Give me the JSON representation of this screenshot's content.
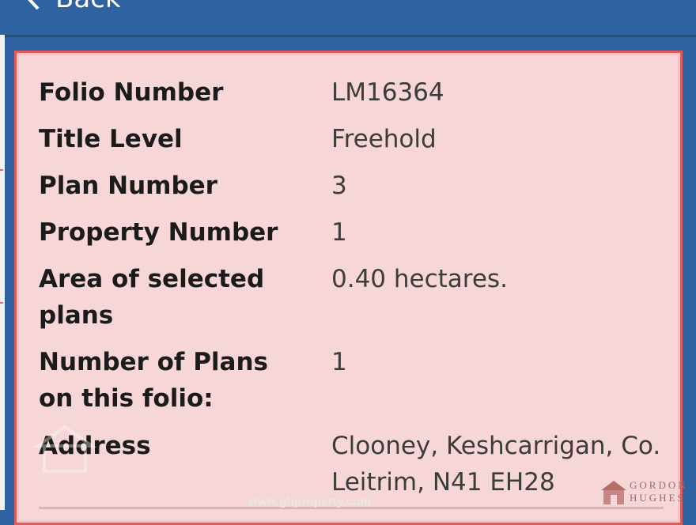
{
  "header": {
    "back_label": "Back"
  },
  "details": {
    "rows": [
      {
        "label": "Folio Number",
        "value": "LM16364"
      },
      {
        "label": "Title Level",
        "value": "Freehold"
      },
      {
        "label": "Plan Number",
        "value": "3"
      },
      {
        "label": "Property Number",
        "value": "1"
      },
      {
        "label": "Area of selected plans",
        "value": "0.40 hectares."
      },
      {
        "label": "Number of Plans on this folio:",
        "value": "1"
      },
      {
        "label": "Address",
        "value": "Clooney, Keshcarrigan, Co. Leitrim, N41 EH28"
      }
    ]
  },
  "watermark": {
    "url": "www.ghproperty.com",
    "brand_line1": "GORDON",
    "brand_line2": "HUGHES"
  },
  "colors": {
    "header_blue": "#2f62a0",
    "panel_bg": "#f7d6d7",
    "panel_border": "#e35a5c"
  }
}
